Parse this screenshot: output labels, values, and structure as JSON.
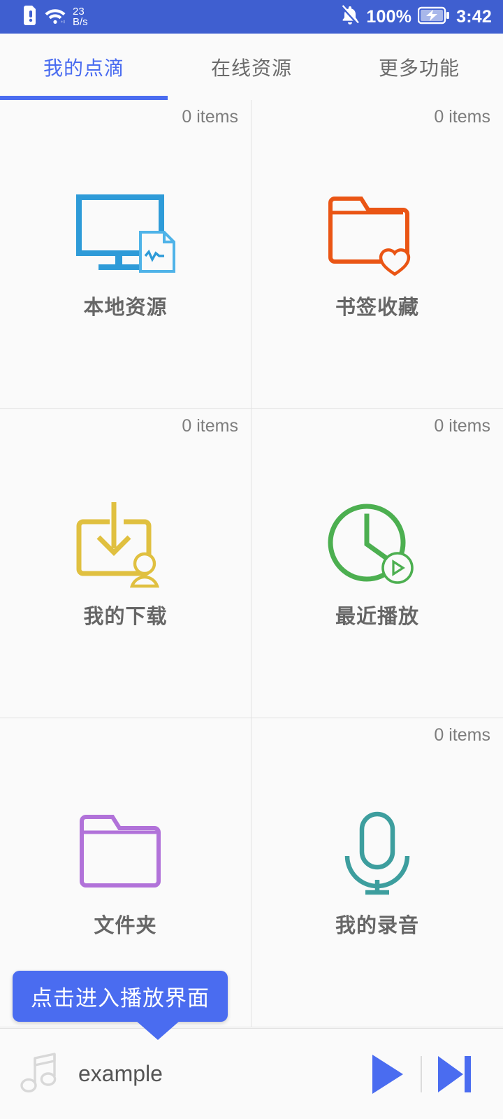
{
  "status_bar": {
    "background": "#3f5fd0",
    "network_speed_value": "23",
    "network_speed_unit": "B/s",
    "battery_percent": "100%",
    "clock": "3:42",
    "icons": {
      "sim_alert": "sim-alert-icon",
      "wifi": "wifi-icon",
      "mute": "bell-mute-icon",
      "battery": "battery-charging-icon"
    }
  },
  "tabs": {
    "active_color": "#4a6cf0",
    "inactive_color": "#6b6b6b",
    "items": [
      {
        "label": "我的点滴",
        "active": true
      },
      {
        "label": "在线资源",
        "active": false
      },
      {
        "label": "更多功能",
        "active": false
      }
    ]
  },
  "grid": {
    "cells": [
      {
        "label": "本地资源",
        "count": "0 items",
        "icon": "monitor-document-icon",
        "color": "#2e9bd8"
      },
      {
        "label": "书签收藏",
        "count": "0 items",
        "icon": "folder-heart-icon",
        "color": "#ea5514"
      },
      {
        "label": "我的下载",
        "count": "0 items",
        "icon": "download-person-icon",
        "color": "#e0c040"
      },
      {
        "label": "最近播放",
        "count": "0 items",
        "icon": "clock-play-icon",
        "color": "#4caf50"
      },
      {
        "label": "文件夹",
        "count": "",
        "icon": "folder-icon",
        "color": "#b172d9"
      },
      {
        "label": "我的录音",
        "count": "0 items",
        "icon": "microphone-icon",
        "color": "#3d9e9e"
      }
    ]
  },
  "tooltip": {
    "text": "点击进入播放界面",
    "background": "#4a6cf0"
  },
  "player": {
    "track_title": "example",
    "note_icon": "music-note-icon",
    "play_button": "play-icon",
    "next_button": "next-track-icon",
    "accent": "#4a6cf0"
  }
}
